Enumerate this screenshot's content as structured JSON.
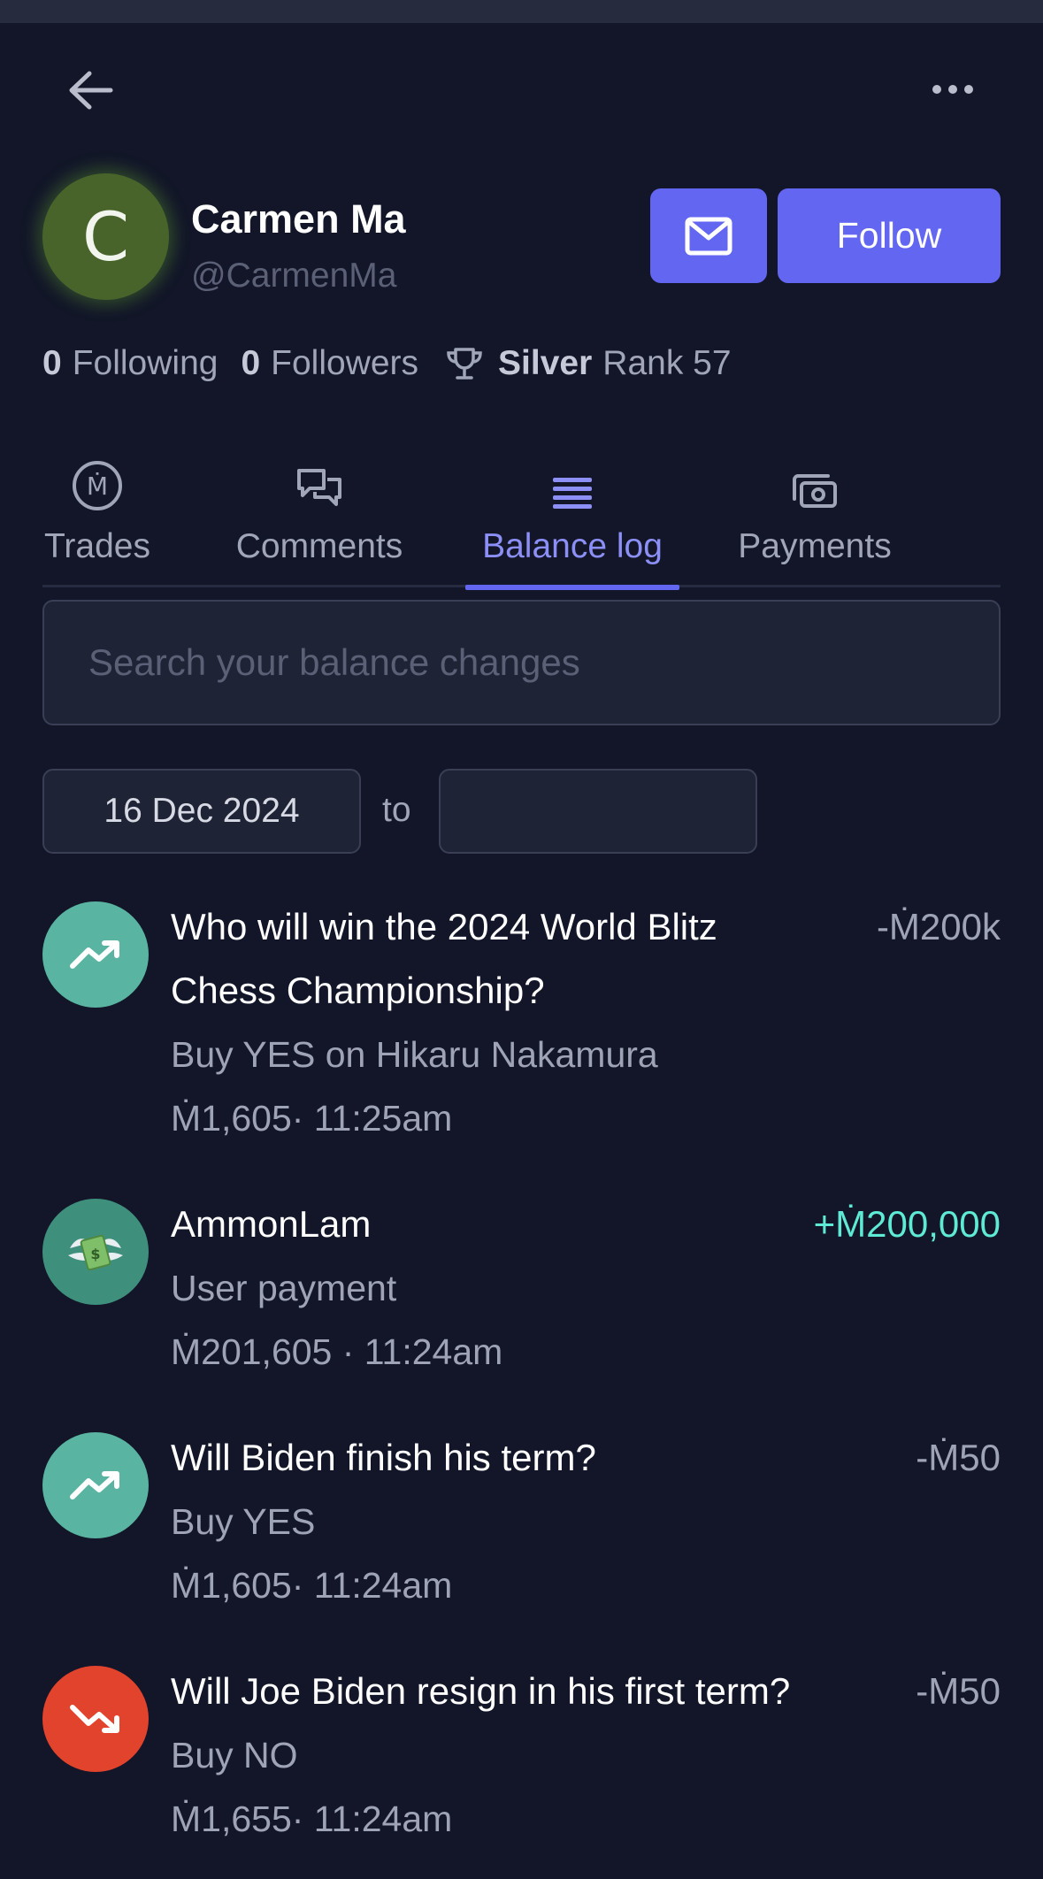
{
  "profile": {
    "avatar_letter": "C",
    "name": "Carmen Ma",
    "handle": "@CarmenMa",
    "follow_label": "Follow",
    "following_count": "0",
    "following_label": "Following",
    "followers_count": "0",
    "followers_label": "Followers",
    "tier": "Silver",
    "rank_label": "Rank 57"
  },
  "tabs": [
    {
      "label": "Trades",
      "icon": "mana-coin-icon"
    },
    {
      "label": "Comments",
      "icon": "chat-bubbles-icon"
    },
    {
      "label": "Balance log",
      "icon": "list-lines-icon",
      "active": true
    },
    {
      "label": "Payments",
      "icon": "cash-icon"
    }
  ],
  "search": {
    "placeholder": "Search your balance changes",
    "value": ""
  },
  "date_range": {
    "from": "16 Dec 2024",
    "to_label": "to",
    "to": ""
  },
  "entries": [
    {
      "icon": "trending-up-icon",
      "title": "Who will win the 2024 World Blitz Chess Championship?",
      "subtitle": "Buy YES on Hikaru Nakamura",
      "meta": "Ṁ1,605· 11:25am",
      "amount": "-Ṁ200k"
    },
    {
      "icon": "money-with-wings-icon",
      "title": "AmmonLam",
      "subtitle": "User payment",
      "meta": "Ṁ201,605 · 11:24am",
      "amount": "+Ṁ200,000"
    },
    {
      "icon": "trending-up-icon",
      "title": "Will Biden finish his term?",
      "subtitle": "Buy YES",
      "meta": "Ṁ1,605· 11:24am",
      "amount": "-Ṁ50"
    },
    {
      "icon": "trending-down-icon",
      "title": "Will Joe Biden resign in his first term?",
      "subtitle": "Buy NO",
      "meta": "Ṁ1,655· 11:24am",
      "amount": "-Ṁ50"
    }
  ],
  "colors": {
    "background": "#121628",
    "accent": "#6366f1",
    "positive": "#5eead4",
    "trade_up": "#5ab4a2",
    "trade_down": "#e2432c"
  }
}
